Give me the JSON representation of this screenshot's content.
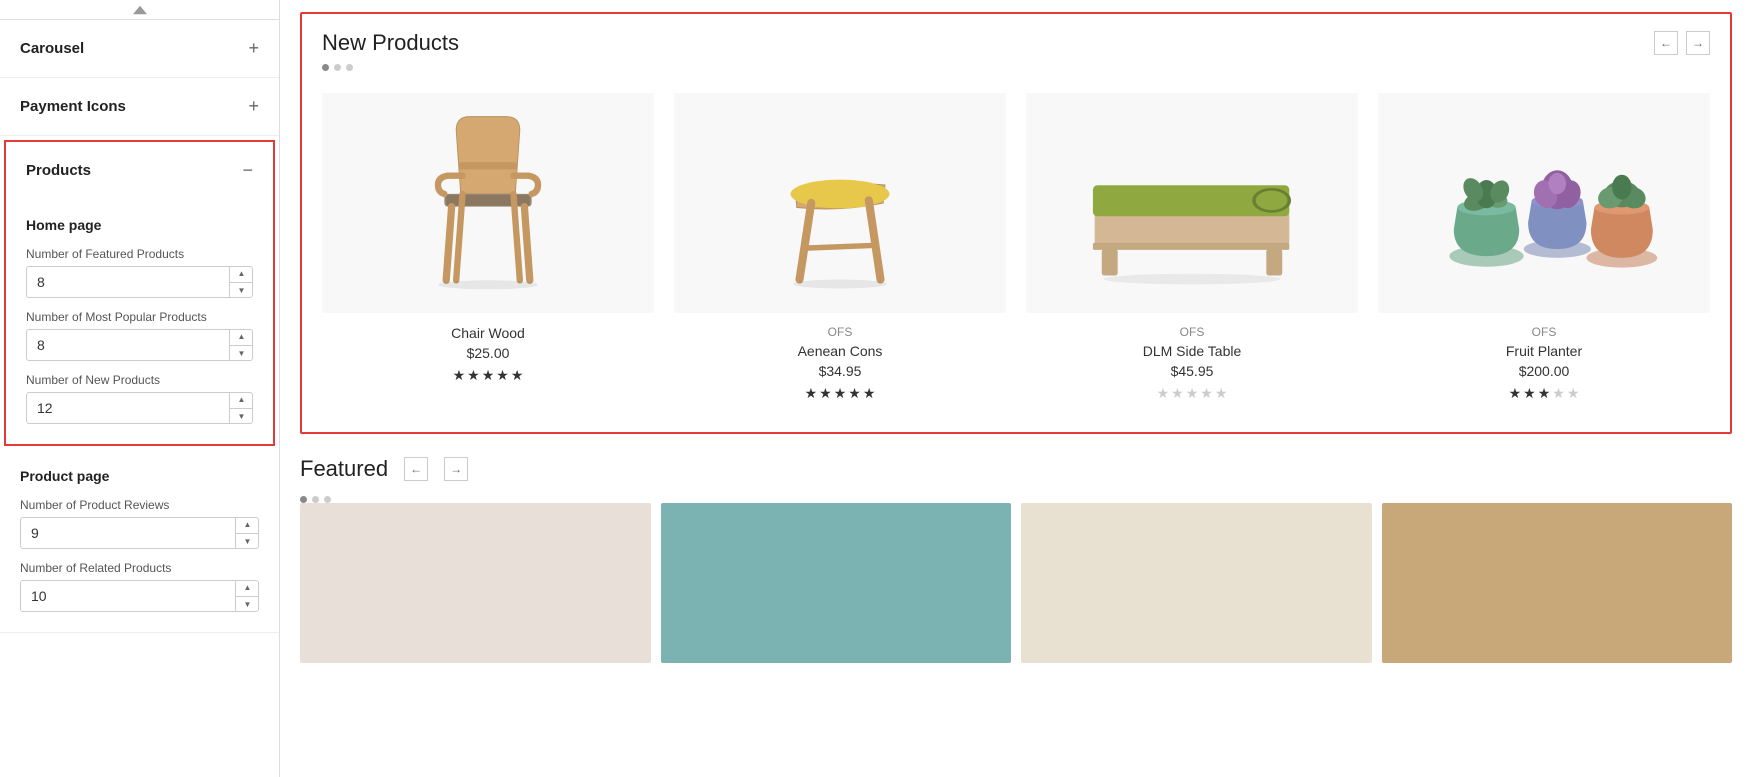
{
  "sidebar": {
    "scroll_indicator": "▲",
    "sections": [
      {
        "id": "carousel",
        "title": "Carousel",
        "icon": "+",
        "expanded": false
      },
      {
        "id": "payment_icons",
        "title": "Payment Icons",
        "icon": "+",
        "expanded": false
      },
      {
        "id": "products",
        "title": "Products",
        "icon": "−",
        "expanded": true,
        "content": {
          "homepage_section": {
            "title": "Home page",
            "fields": [
              {
                "id": "featured_products",
                "label": "Number of Featured Products",
                "value": "8"
              },
              {
                "id": "popular_products",
                "label": "Number of Most Popular Products",
                "value": "8"
              },
              {
                "id": "new_products",
                "label": "Number of New Products",
                "value": "12"
              }
            ]
          },
          "product_page_section": {
            "title": "Product page",
            "fields": [
              {
                "id": "product_reviews",
                "label": "Number of Product Reviews",
                "value": "9"
              },
              {
                "id": "related_products",
                "label": "Number of Related Products",
                "value": "10"
              }
            ]
          }
        }
      }
    ]
  },
  "main": {
    "new_products": {
      "title": "New Products",
      "products": [
        {
          "id": 1,
          "vendor": "",
          "name": "Chair Wood",
          "price": "$25.00",
          "stars": 4.5,
          "filled_stars": 4,
          "half_star": true,
          "empty_stars": 0,
          "type": "chair"
        },
        {
          "id": 2,
          "vendor": "OFS",
          "name": "Aenean Cons",
          "price": "$34.95",
          "stars": 5,
          "filled_stars": 5,
          "half_star": false,
          "empty_stars": 0,
          "type": "bench"
        },
        {
          "id": 3,
          "vendor": "OFS",
          "name": "DLM Side Table",
          "price": "$45.95",
          "stars": 0,
          "filled_stars": 0,
          "half_star": false,
          "empty_stars": 5,
          "type": "daybed"
        },
        {
          "id": 4,
          "vendor": "OFS",
          "name": "Fruit Planter",
          "price": "$200.00",
          "stars": 3,
          "filled_stars": 3,
          "half_star": false,
          "empty_stars": 2,
          "type": "planters"
        }
      ]
    },
    "featured": {
      "title": "Featured",
      "nav": {
        "prev": "←",
        "next": "→"
      }
    }
  },
  "icons": {
    "chevron_up": "▲",
    "chevron_down": "▼",
    "arrow_left": "←",
    "arrow_right": "→",
    "expand": "+",
    "collapse": "−",
    "star_filled": "★",
    "star_empty": "☆"
  }
}
